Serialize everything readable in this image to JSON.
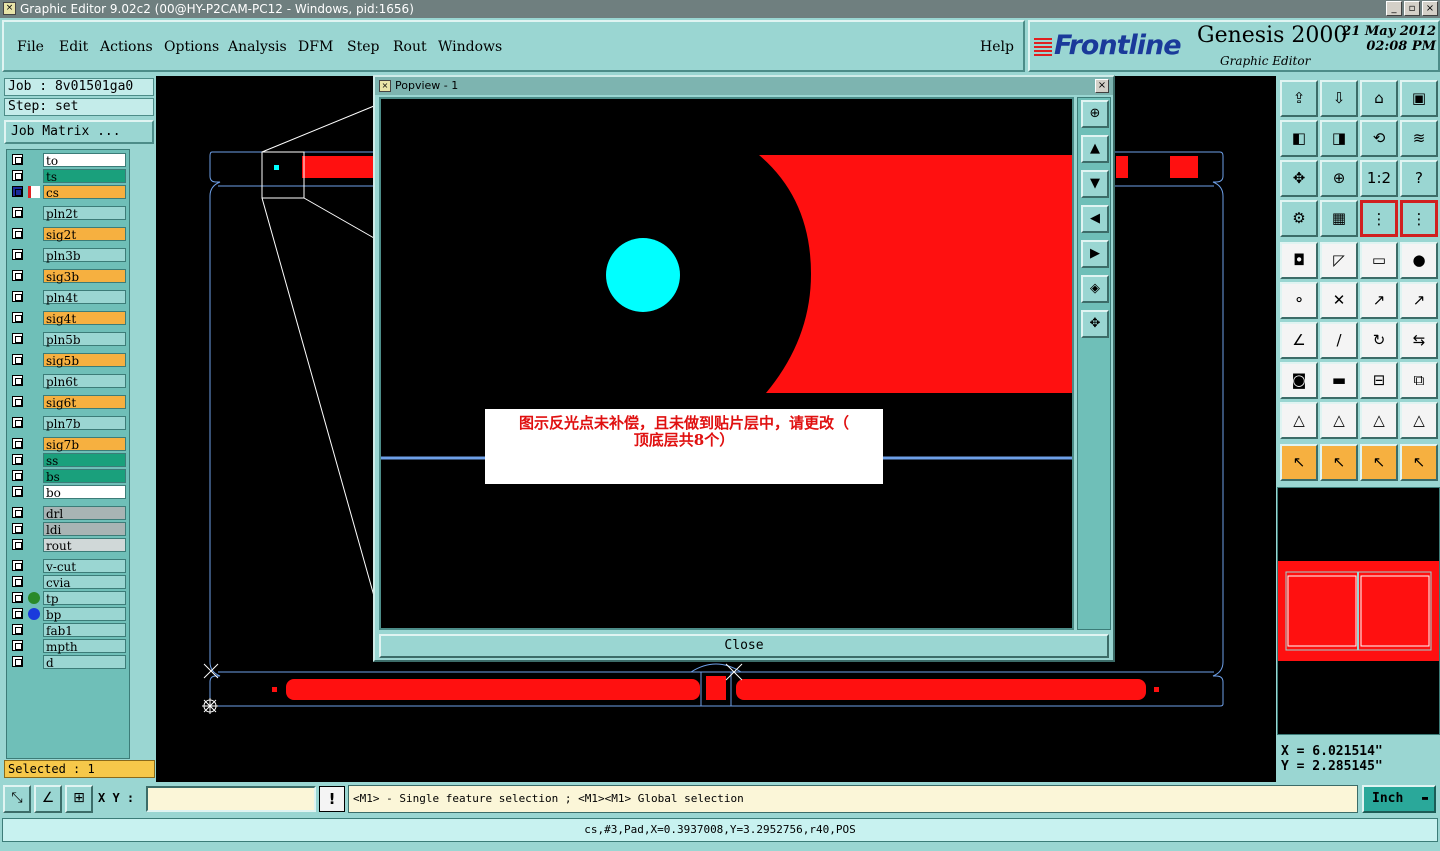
{
  "window": {
    "title": "Graphic Editor 9.02c2 (00@HY-P2CAM-PC12 - Windows, pid:1656)",
    "buttons": [
      "_",
      "▫",
      "×"
    ]
  },
  "menu": {
    "items": [
      "File",
      "Edit",
      "Actions",
      "Options",
      "Analysis",
      "DFM",
      "Step",
      "Rout",
      "Windows"
    ],
    "help": "Help"
  },
  "brand": {
    "logo": "Frontline",
    "product": "Genesis 2000",
    "subtitle": "Graphic Editor",
    "date": "21 May 2012",
    "time": "02:08 PM"
  },
  "job": {
    "job_label": "Job : 8v01501ga0",
    "step_label": "Step: set",
    "matrix_button": "Job Matrix ..."
  },
  "layers": [
    {
      "name": "to",
      "color": "#ffffff"
    },
    {
      "name": "ts",
      "color": "#1aa07c"
    },
    {
      "name": "cs",
      "color": "#f6b040",
      "active": true
    },
    {
      "name": "pln2t",
      "color": "#9ad6d2"
    },
    {
      "name": "sig2t",
      "color": "#f6b040"
    },
    {
      "name": "pln3b",
      "color": "#9ad6d2"
    },
    {
      "name": "sig3b",
      "color": "#f6b040"
    },
    {
      "name": "pln4t",
      "color": "#9ad6d2"
    },
    {
      "name": "sig4t",
      "color": "#f6b040"
    },
    {
      "name": "pln5b",
      "color": "#9ad6d2"
    },
    {
      "name": "sig5b",
      "color": "#f6b040"
    },
    {
      "name": "pln6t",
      "color": "#9ad6d2"
    },
    {
      "name": "sig6t",
      "color": "#f6b040"
    },
    {
      "name": "pln7b",
      "color": "#9ad6d2"
    },
    {
      "name": "sig7b",
      "color": "#f6b040"
    },
    {
      "name": "ss",
      "color": "#1aa07c"
    },
    {
      "name": "bs",
      "color": "#1aa07c"
    },
    {
      "name": "bo",
      "color": "#ffffff"
    },
    {
      "name": "drl",
      "color": "#a8b4b4"
    },
    {
      "name": "ldi",
      "color": "#a8b4b4"
    },
    {
      "name": "rout",
      "color": "#d0d8d8"
    },
    {
      "name": "v-cut",
      "color": "#9ad6d2"
    },
    {
      "name": "cvia",
      "color": "#9ad6d2"
    },
    {
      "name": "tp",
      "color": "#9ad6d2",
      "dot": "#2a8a2a"
    },
    {
      "name": "bp",
      "color": "#9ad6d2",
      "dot": "#1a3adc"
    },
    {
      "name": "fab1",
      "color": "#9ad6d2"
    },
    {
      "name": "mpth",
      "color": "#9ad6d2"
    },
    {
      "name": "d",
      "color": "#9ad6d2"
    }
  ],
  "selected": "Selected : 1",
  "popview": {
    "title": "Popview - 1",
    "close_x": "×",
    "close_button": "Close",
    "annotation_line1": "图示反光点未补偿，且未做到贴片层中，请更改（",
    "annotation_line2": "顶底层共8个）"
  },
  "coords": {
    "x": "X = 6.021514\"",
    "y": "Y = 2.285145\""
  },
  "bottom": {
    "xy_label": "X Y :",
    "xy_value": "",
    "bang": "!",
    "hint": "<M1> - Single feature selection ; <M1><M1> Global selection",
    "units": "Inch",
    "units_arrow": "▬"
  },
  "status": "cs,#3,Pad,X=0.3937008,Y=3.2952756,r40,POS",
  "toolbar_icons": [
    "zoom-home-icon",
    "zoom-in-icon",
    "zoom-fit-icon",
    "pan-icon",
    "move-left-icon",
    "move-right-icon",
    "rotate-icon",
    "snap-icon",
    "fit-icon",
    "center-icon",
    "ratio-icon",
    "help-icon",
    "options-icon",
    "grid-icon",
    "layer-a-icon",
    "layer-b-icon",
    "pad-icon",
    "pick-icon",
    "measure-icon",
    "fill-icon",
    "connect-icon",
    "cross-icon",
    "line-a-icon",
    "line-b-icon",
    "angle-icon",
    "slash-icon",
    "arc-icon",
    "mirror-icon",
    "pad-b-icon",
    "line-c-icon",
    "distance-icon",
    "copy-icon",
    "triangle-a-icon",
    "triangle-b-icon",
    "triangle-c-icon",
    "triangle-d-icon",
    "select-icon",
    "select-b-icon",
    "select-c-icon",
    "select-d-icon"
  ],
  "toolbar_labels": {
    "ratio": "1:2",
    "help": "?"
  }
}
